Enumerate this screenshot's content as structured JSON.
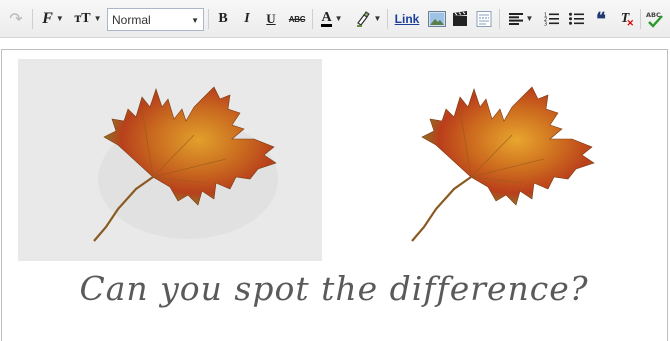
{
  "toolbar": {
    "format_value": "Normal",
    "link_label": "Link",
    "strikethrough_label": "ABC",
    "font_size_label": "тT",
    "spell_label": "ABC",
    "icons": [
      "redo-icon",
      "font-family-icon",
      "font-size-icon",
      "bold-icon",
      "italic-icon",
      "underline-icon",
      "strikethrough-icon",
      "text-color-icon",
      "highlight-icon",
      "image-icon",
      "video-icon",
      "jump-break-icon",
      "align-icon",
      "numbered-list-icon",
      "bulleted-list-icon",
      "quote-icon",
      "remove-formatting-icon",
      "spellcheck-icon"
    ]
  },
  "editor": {
    "caption": "Can you spot the difference?",
    "photos": [
      "maple-leaf-photo-original",
      "maple-leaf-photo-edited"
    ]
  },
  "colors": {
    "toolbar_bg": "#efefef",
    "link_color": "#1b3e9c",
    "caption_color": "#5a5a5a",
    "left_photo_bg": "#e9e9e9"
  }
}
